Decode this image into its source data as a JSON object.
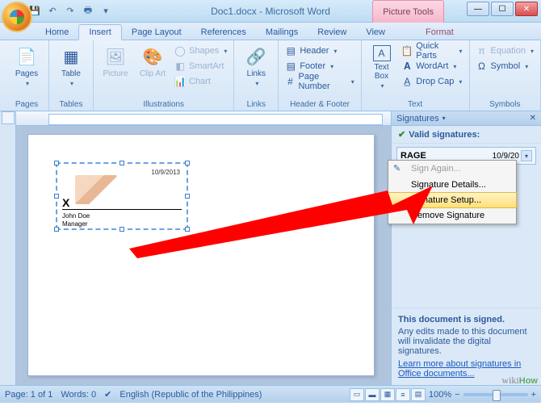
{
  "title": "Doc1.docx - Microsoft Word",
  "contextual_tab_group": "Picture Tools",
  "tabs": [
    "Home",
    "Insert",
    "Page Layout",
    "References",
    "Mailings",
    "Review",
    "View"
  ],
  "context_tab": "Format",
  "active_tab_index": 1,
  "ribbon": {
    "pages": {
      "label": "Pages",
      "btn": "Pages"
    },
    "tables": {
      "label": "Tables",
      "btn": "Table"
    },
    "illustrations": {
      "label": "Illustrations",
      "picture": "Picture",
      "clipart": "Clip Art",
      "shapes": "Shapes",
      "smartart": "SmartArt",
      "chart": "Chart"
    },
    "links": {
      "label": "Links",
      "btn": "Links"
    },
    "headerfooter": {
      "label": "Header & Footer",
      "header": "Header",
      "footer": "Footer",
      "pagenum": "Page Number"
    },
    "text": {
      "label": "Text",
      "textbox": "Text Box",
      "quickparts": "Quick Parts",
      "wordart": "WordArt",
      "dropcap": "Drop Cap"
    },
    "symbols": {
      "label": "Symbols",
      "equation": "Equation",
      "symbol": "Symbol"
    }
  },
  "taskpane": {
    "title": "Signatures",
    "section": "Valid signatures:",
    "sig_name": "RAGE",
    "sig_date": "10/9/20",
    "menu": {
      "sign_again": "Sign Again...",
      "details": "Signature Details...",
      "setup": "Signature Setup...",
      "remove": "Remove Signature"
    },
    "info_title": "This document is signed.",
    "info_body": "Any edits made to this document will invalidate the digital signatures.",
    "info_link": "Learn more about signatures in Office documents..."
  },
  "sigblock": {
    "date": "10/9/2013",
    "x": "X",
    "name": "John Doe",
    "role": "Manager"
  },
  "status": {
    "page": "Page: 1 of 1",
    "words": "Words: 0",
    "lang": "English (Republic of the Philippines)",
    "zoom": "100%"
  },
  "watermark": "wikiHow"
}
